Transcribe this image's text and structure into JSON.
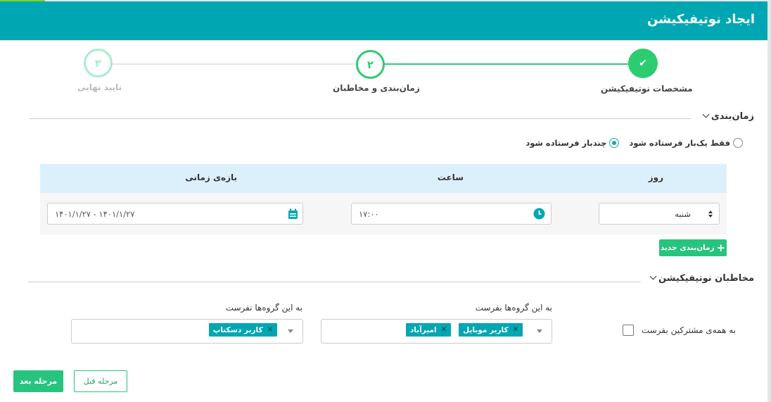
{
  "header": {
    "title": "ایجاد نوتیفیکیشن"
  },
  "stepper": {
    "steps": [
      {
        "number": "✔",
        "label": "مشخصات نوتیفیکیشن",
        "state": "done"
      },
      {
        "number": "۲",
        "label": "زمان‌بندی و مخاطبان",
        "state": "active"
      },
      {
        "number": "۳",
        "label": "تایید نهایی",
        "state": "pending"
      }
    ]
  },
  "scheduling": {
    "title": "زمان‌بندی",
    "radios": [
      {
        "label": "فقط یک‌بار فرستاده شود",
        "checked": false
      },
      {
        "label": "چندبار فرستاده شود",
        "checked": true
      }
    ],
    "table": {
      "headers": {
        "day": "روز",
        "time": "ساعت",
        "range": "بازه‌ی زمانی"
      },
      "row": {
        "day": "شنبه",
        "time": "۱۷:۰۰",
        "range": "۱۴۰۱/۱/۲۷ - ۱۴۰۱/۱/۲۷"
      }
    },
    "add_button": "زمان‌بندی جدید"
  },
  "audience": {
    "title": "مخاطبان نوتیفیکیشن",
    "all_subscribers_label": "به همه‌ی مشترکین بفرست",
    "send_to": {
      "label": "به این گروه‌ها بفرست",
      "tags": [
        "کاربر موبایل",
        "امیرآباد"
      ]
    },
    "dont_send_to": {
      "label": "به این گروه‌ها نفرست",
      "tags": [
        "کاربر دسکتاپ"
      ]
    }
  },
  "footer": {
    "prev_label": "مرحله قبل",
    "next_label": "مرحله بعد"
  },
  "colors": {
    "header": "#00a7b3",
    "accent_green": "#27c47d",
    "stepper_green": "#2ecc71"
  }
}
